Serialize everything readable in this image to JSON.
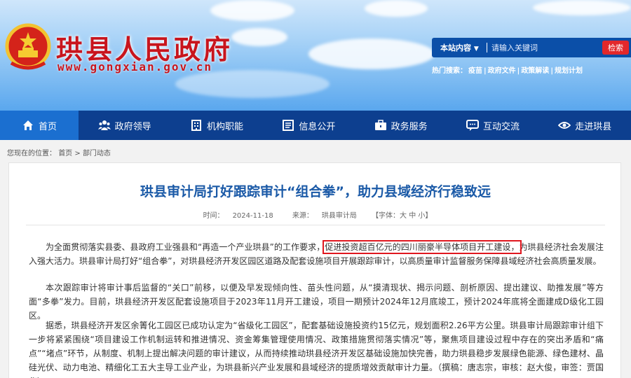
{
  "header": {
    "site_title": "珙县人民政府",
    "site_url": "www.gongxian.gov.cn",
    "search": {
      "scope": "本站内容",
      "placeholder": "请输入关键词",
      "button_label": "检索"
    },
    "hot_search": {
      "label": "热门搜索：",
      "items": [
        "疫苗",
        "政府文件",
        "政策解读",
        "规划计划"
      ]
    }
  },
  "nav": {
    "items": [
      {
        "label": "首页",
        "icon": "home-icon"
      },
      {
        "label": "政府领导",
        "icon": "people-icon"
      },
      {
        "label": "机构职能",
        "icon": "building-icon"
      },
      {
        "label": "信息公开",
        "icon": "document-icon"
      },
      {
        "label": "政务服务",
        "icon": "briefcase-icon"
      },
      {
        "label": "互动交流",
        "icon": "chat-icon"
      },
      {
        "label": "走进珙县",
        "icon": "eye-icon"
      }
    ]
  },
  "breadcrumb": {
    "prefix": "您现在的位置：",
    "home": "首页",
    "sep": " > ",
    "current": "部门动态"
  },
  "article": {
    "title": "珙县审计局打好跟踪审计“组合拳”，助力县域经济行稳致远",
    "time_label": "时间：",
    "time": "2024-11-18",
    "source_label": "来源：",
    "source": "珙县审计局",
    "font_label": "【字体：大 中 小】",
    "p1_a": "为全面贯彻落实县委、县政府工业强县和“再造一个产业珙县”的工作要求，",
    "p1_highlight": "促进投资超百亿元的四川丽豪半导体项目开工建设，",
    "p1_b": "为珙县经济社会发展注入强大活力。珙县审计局打好“组合拳”，对珙县经济开发区园区道路及配套设施项目开展跟踪审计，以高质量审计监督服务保障县域经济社会高质量发展。",
    "p2": "本次跟踪审计将审计事后监督的“关口”前移，以便及早发现倾向性、苗头性问题，从“摸清现状、揭示问题、剖析原因、提出建议、助推发展”等方面“多拳”发力。目前，珙县经济开发区配套设施项目于2023年11月开工建设，项目一期预计2024年12月底竣工，预计2024年底将全面建成D级化工园区。",
    "p3": "据悉，珙县经济开发区余箐化工园区已成功认定为“省级化工园区”，配套基础设施投资约15亿元，规划面积2.26平方公里。珙县审计局跟踪审计组下一步将紧紧围绕“项目建设工作机制运转和推进情况、资金筹集管理使用情况、政策措施贯彻落实情况”等，聚焦项目建设过程中存在的突出矛盾和“痛点”“堵点”环节，从制度、机制上提出解决问题的审计建议，从而持续推动珙县经济开发区基础设施加快完善，助力珙县稳步发展绿色能源、绿色建材、晶硅光伏、动力电池、精细化工五大主导工业产业，为珙县新兴产业发展和县域经济的提质增效贡献审计力量。（撰稿：唐志宗，审核：赵大俊，审签：贾国华）"
  },
  "colors": {
    "nav_bg": "#0d3f8f",
    "nav_active": "#1b6fd0",
    "title_red": "#c8151d",
    "article_title_blue": "#1b5aa7",
    "highlight_red": "#e0171f"
  }
}
